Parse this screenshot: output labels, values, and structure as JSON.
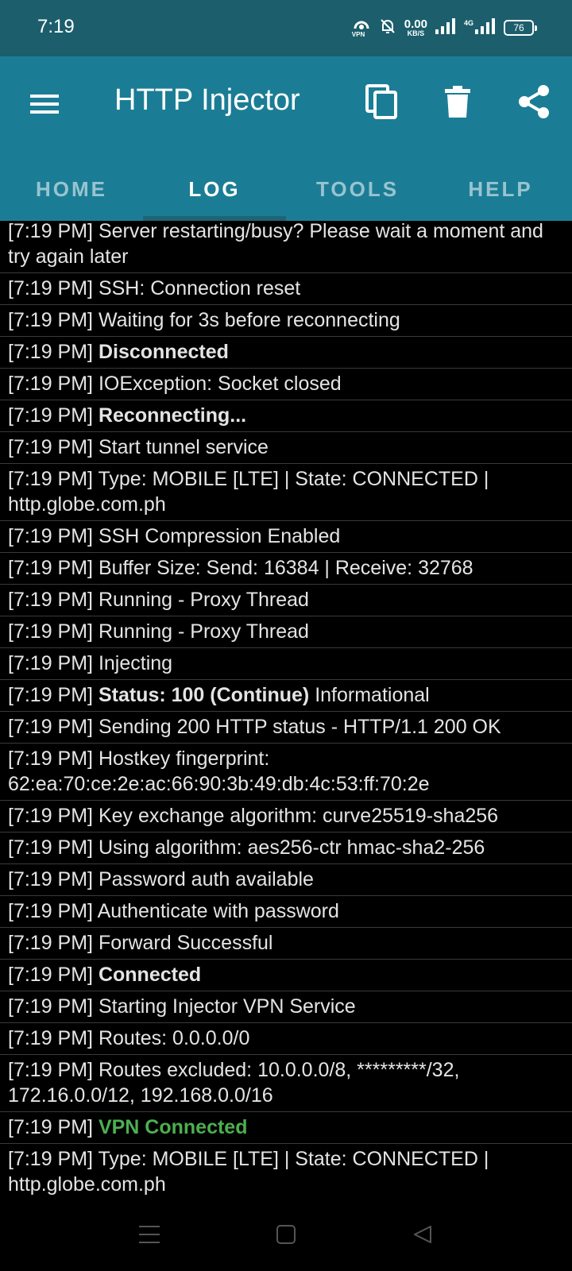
{
  "status_bar": {
    "time": "7:19",
    "vpn_label": "VPN",
    "speed_value": "0.00",
    "speed_unit": "KB/S",
    "network_label": "4G",
    "battery": "76"
  },
  "app_bar": {
    "title": "HTTP Injector",
    "actions": [
      "copy-icon",
      "trash-icon",
      "share-icon"
    ]
  },
  "tabs": [
    {
      "label": "HOME"
    },
    {
      "label": "LOG"
    },
    {
      "label": "TOOLS"
    },
    {
      "label": "HELP"
    }
  ],
  "log_entries": [
    {
      "time": "[7:19 PM]",
      "bold": "",
      "text": "Server restarting/busy? Please wait a moment and try again later",
      "color": ""
    },
    {
      "time": "[7:19 PM]",
      "bold": "",
      "text": "SSH: Connection reset",
      "color": ""
    },
    {
      "time": "[7:19 PM]",
      "bold": "",
      "text": "Waiting for 3s before reconnecting",
      "color": ""
    },
    {
      "time": "[7:19 PM]",
      "bold": "Disconnected",
      "text": "",
      "color": ""
    },
    {
      "time": "[7:19 PM]",
      "bold": "",
      "text": "IOException: Socket closed",
      "color": ""
    },
    {
      "time": "[7:19 PM]",
      "bold": "Reconnecting...",
      "text": "",
      "color": ""
    },
    {
      "time": "[7:19 PM]",
      "bold": "",
      "text": "Start tunnel service",
      "color": ""
    },
    {
      "time": "[7:19 PM]",
      "bold": "",
      "text": "Type: MOBILE [LTE] | State: CONNECTED | http.globe.com.ph",
      "color": ""
    },
    {
      "time": "[7:19 PM]",
      "bold": "",
      "text": "SSH Compression Enabled",
      "color": ""
    },
    {
      "time": "[7:19 PM]",
      "bold": "",
      "text": "Buffer Size: Send: 16384 | Receive: 32768",
      "color": ""
    },
    {
      "time": "[7:19 PM]",
      "bold": "",
      "text": "Running - Proxy Thread",
      "color": ""
    },
    {
      "time": "[7:19 PM]",
      "bold": "",
      "text": "Running - Proxy Thread",
      "color": ""
    },
    {
      "time": "[7:19 PM]",
      "bold": "",
      "text": "Injecting",
      "color": ""
    },
    {
      "time": "[7:19 PM]",
      "bold": "Status: 100 (Continue)",
      "text": "Informational",
      "color": ""
    },
    {
      "time": "[7:19 PM]",
      "bold": "",
      "text": "Sending 200 HTTP status - HTTP/1.1 200 OK",
      "color": ""
    },
    {
      "time": "[7:19 PM]",
      "bold": "",
      "text": "Hostkey fingerprint: 62:ea:70:ce:2e:ac:66:90:3b:49:db:4c:53:ff:70:2e",
      "color": ""
    },
    {
      "time": "[7:19 PM]",
      "bold": "",
      "text": "Key exchange algorithm: curve25519-sha256",
      "color": ""
    },
    {
      "time": "[7:19 PM]",
      "bold": "",
      "text": "Using algorithm: aes256-ctr hmac-sha2-256",
      "color": ""
    },
    {
      "time": "[7:19 PM]",
      "bold": "",
      "text": "Password auth available",
      "color": ""
    },
    {
      "time": "[7:19 PM]",
      "bold": "",
      "text": "Authenticate with password",
      "color": ""
    },
    {
      "time": "[7:19 PM]",
      "bold": "",
      "text": "Forward Successful",
      "color": ""
    },
    {
      "time": "[7:19 PM]",
      "bold": "Connected",
      "text": "",
      "color": ""
    },
    {
      "time": "[7:19 PM]",
      "bold": "",
      "text": "Starting Injector VPN Service",
      "color": ""
    },
    {
      "time": "[7:19 PM]",
      "bold": "",
      "text": "Routes: 0.0.0.0/0",
      "color": ""
    },
    {
      "time": "[7:19 PM]",
      "bold": "",
      "text": "Routes excluded: 10.0.0.0/8, *********/32, 172.16.0.0/12, 192.168.0.0/16",
      "color": ""
    },
    {
      "time": "[7:19 PM]",
      "bold": "VPN Connected",
      "text": "",
      "color": "#4caf50"
    },
    {
      "time": "[7:19 PM]",
      "bold": "",
      "text": "Type: MOBILE [LTE] | State: CONNECTED | http.globe.com.ph",
      "color": ""
    }
  ],
  "nav_bar": [
    "recents-menu-icon",
    "home-square-icon",
    "back-triangle-icon"
  ]
}
